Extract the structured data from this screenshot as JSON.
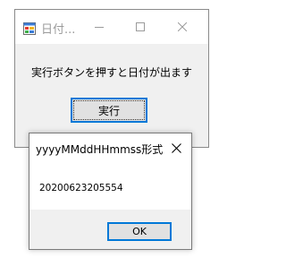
{
  "main_window": {
    "title": "日付...",
    "icon": "app-form-icon",
    "message": "実行ボタンを押すと日付が出ます",
    "execute_button": "実行",
    "controls": [
      "minimize-icon",
      "maximize-icon",
      "close-icon"
    ]
  },
  "dialog": {
    "title": "yyyyMMddHHmmss形式",
    "value": "20200623205554",
    "ok_button": "OK",
    "controls": [
      "close-icon"
    ]
  },
  "colors": {
    "focus_border": "#0078d7",
    "window_bg": "#f0f0f0",
    "button_bg": "#e1e1e1",
    "inactive_title": "#9b9b9b"
  }
}
